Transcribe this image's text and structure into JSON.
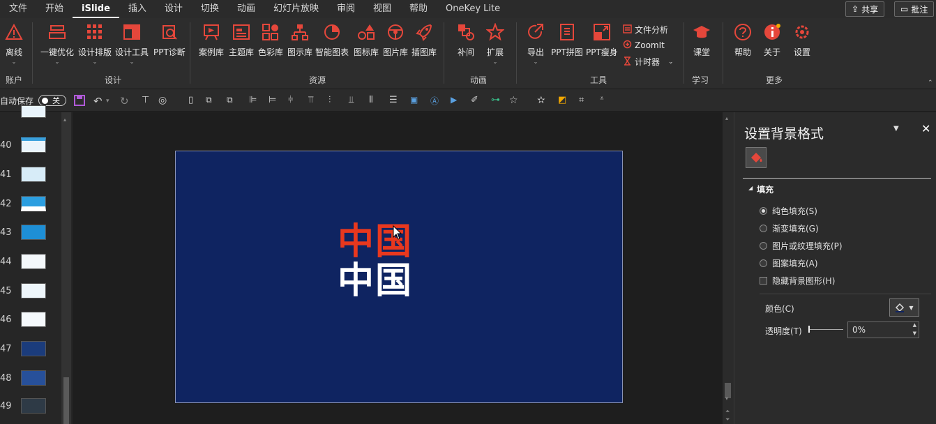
{
  "tabs": [
    "文件",
    "开始",
    "iSlide",
    "插入",
    "设计",
    "切换",
    "动画",
    "幻灯片放映",
    "审阅",
    "视图",
    "帮助",
    "OneKey Lite"
  ],
  "active_tab": "iSlide",
  "top_buttons": {
    "share": "共享",
    "comment": "批注"
  },
  "ribbon": {
    "account": {
      "offline": "离线",
      "group": "账户"
    },
    "design": {
      "items": [
        "一键优化",
        "设计排版",
        "设计工具",
        "PPT诊断"
      ],
      "group": "设计"
    },
    "resources": {
      "items": [
        "案例库",
        "主题库",
        "色彩库",
        "图示库",
        "智能图表",
        "图标库",
        "图片库",
        "插图库"
      ],
      "group": "资源"
    },
    "animation": {
      "items": [
        "补间",
        "扩展"
      ],
      "group": "动画"
    },
    "tools": {
      "items": [
        "导出",
        "PPT拼图",
        "PPT瘦身"
      ],
      "small": [
        "文件分析",
        "ZoomIt",
        "计时器"
      ],
      "group": "工具"
    },
    "learn": {
      "items": [
        "课堂"
      ],
      "group": "学习"
    },
    "more": {
      "items": [
        "帮助",
        "关于",
        "设置"
      ],
      "group": "更多"
    }
  },
  "qat": {
    "autosave": "自动保存",
    "toggle": "关"
  },
  "thumbnails": [
    "40",
    "41",
    "42",
    "43",
    "44",
    "45",
    "46",
    "47",
    "48",
    "49"
  ],
  "slide": {
    "text_red": "中国",
    "text_white": "中国"
  },
  "pane": {
    "title": "设置背景格式",
    "section": "填充",
    "options": [
      "纯色填充(S)",
      "渐变填充(G)",
      "图片或纹理填充(P)",
      "图案填充(A)"
    ],
    "hide_bg": "隐藏背景图形(H)",
    "color_label": "颜色(C)",
    "transparency_label": "透明度(T)",
    "transparency_value": "0%"
  },
  "colors": {
    "accent_red": "#e8381e",
    "slide_bg": "#0f2461"
  }
}
